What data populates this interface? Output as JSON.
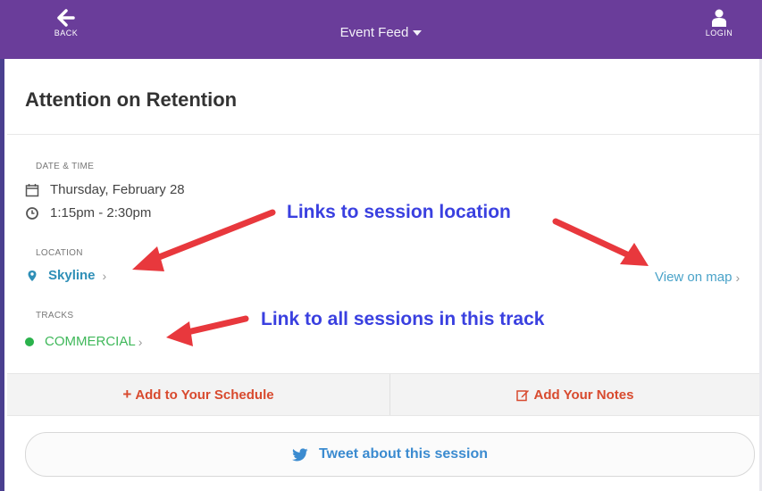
{
  "header": {
    "back_label": "BACK",
    "title": "Event Feed",
    "login_label": "LOGIN",
    "bg_color": "#6a3d9a"
  },
  "session": {
    "title": "Attention on Retention"
  },
  "datetime": {
    "label": "DATE & TIME",
    "date": "Thursday, February 28",
    "time": "1:15pm - 2:30pm"
  },
  "location": {
    "label": "LOCATION",
    "name": "Skyline",
    "view_map": "View on map"
  },
  "tracks": {
    "label": "TRACKS",
    "name": "COMMERCIAL"
  },
  "annotations": {
    "location_note": "Links to session location",
    "track_note": "Link to all sessions in this track",
    "color": "#3a40e0",
    "arrow_color": "#e8383d"
  },
  "actions": {
    "add_schedule": "Add to Your Schedule",
    "add_notes": "Add Your Notes",
    "tweet": "Tweet about this session"
  },
  "icons": {
    "back": "arrow-left-icon",
    "login": "user-icon",
    "calendar": "calendar-icon",
    "clock": "clock-icon",
    "pin": "map-pin-icon",
    "plus": "plus-icon",
    "edit": "edit-icon",
    "twitter": "twitter-icon"
  }
}
